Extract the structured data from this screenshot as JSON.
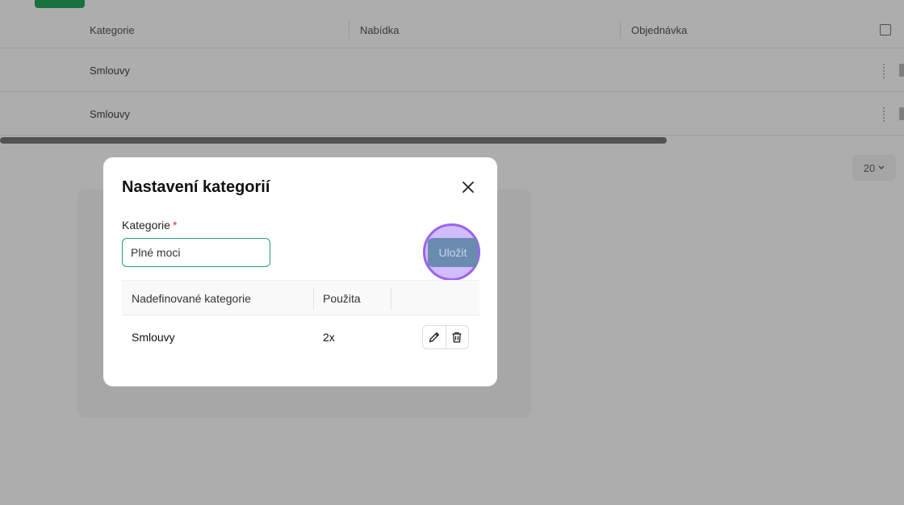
{
  "background": {
    "columns": [
      "Kategorie",
      "Nabídka",
      "Objednávka"
    ],
    "rows": [
      "Smlouvy",
      "Smlouvy"
    ],
    "pager": "20"
  },
  "modal": {
    "title": "Nastavení kategorií",
    "close_icon": "close-icon",
    "field_label": "Kategorie",
    "required_mark": "*",
    "input_value": "Plné moci",
    "save_label": "Uložit",
    "table": {
      "headers": [
        "Nadefinované kategorie",
        "Použita"
      ],
      "rows": [
        {
          "name": "Smlouvy",
          "used": "2x"
        }
      ]
    }
  },
  "colors": {
    "accent_green": "#2e9e6b",
    "save_button": "#6a8bb0",
    "highlight_ring": "#9b62ee"
  }
}
